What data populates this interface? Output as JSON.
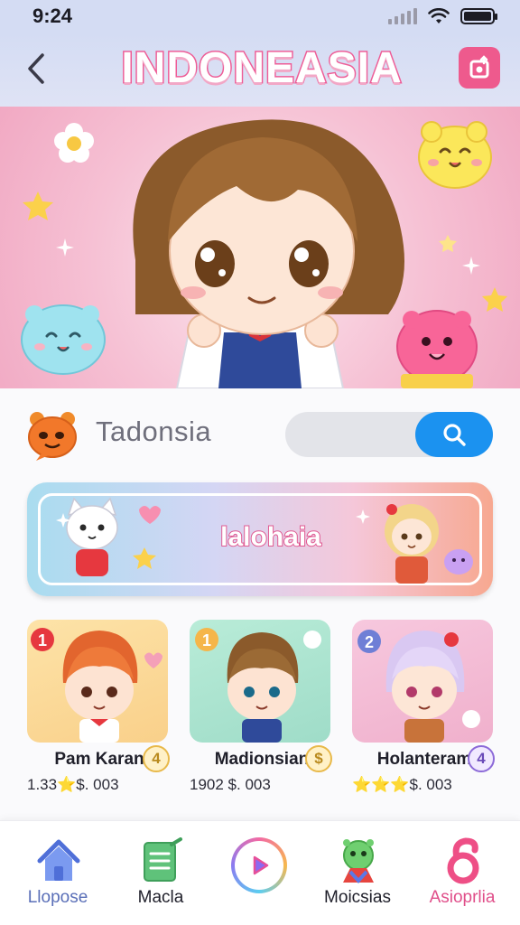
{
  "status_bar": {
    "time": "9:24"
  },
  "header": {
    "title": "INDONEASIA"
  },
  "search_row": {
    "brand_name": "Tadonsia",
    "search_placeholder": ""
  },
  "banner": {
    "title": "lalohaia"
  },
  "cards": [
    {
      "name": "Pam Karan",
      "badge": "4",
      "stats": "1.33⭐$. 003"
    },
    {
      "name": "Madionsian",
      "badge": "$",
      "stats": "1902 $. 003"
    },
    {
      "name": "Holanteram",
      "badge": "4",
      "stats": "⭐⭐⭐$. 003"
    }
  ],
  "card_ranks": [
    "1",
    "1",
    "2"
  ],
  "bottom_nav": {
    "items": [
      {
        "label": "Llopose",
        "icon": "home-icon"
      },
      {
        "label": "Macla",
        "icon": "notes-icon"
      },
      {
        "label": "",
        "icon": "play-icon"
      },
      {
        "label": "Moicsias",
        "icon": "character-icon"
      },
      {
        "label": "Asioprlia",
        "icon": "profile-icon"
      }
    ]
  },
  "colors": {
    "accent_pink": "#ee5a8d",
    "search_blue": "#1b92f0",
    "header_bg": "#d4dcf3"
  }
}
